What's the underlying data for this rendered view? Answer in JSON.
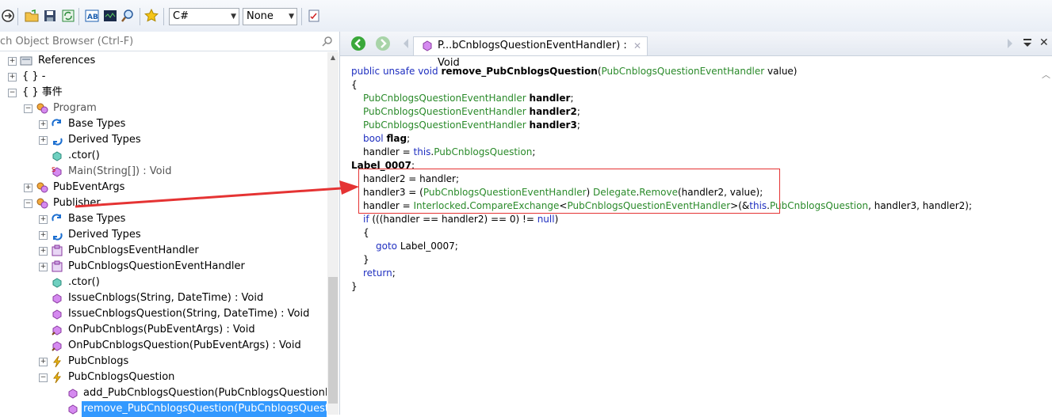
{
  "toolbar": {
    "language": "C#",
    "optimization": "None",
    "colors": {
      "back_icon": "#2c2c2c"
    }
  },
  "browser": {
    "search_placeholder": "ch Object Browser (Ctrl-F)",
    "tree": [
      {
        "label": "References"
      },
      {
        "label": "{ } -"
      },
      {
        "label": "{ } 事件"
      },
      {
        "label": "Program"
      },
      {
        "label": "Base Types"
      },
      {
        "label": "Derived Types"
      },
      {
        "label": ".ctor()"
      },
      {
        "label": "Main(String[]) : Void"
      },
      {
        "label": "PubEventArgs"
      },
      {
        "label": "Publisher"
      },
      {
        "label": "Base Types"
      },
      {
        "label": "Derived Types"
      },
      {
        "label": "PubCnblogsEventHandler"
      },
      {
        "label": "PubCnblogsQuestionEventHandler"
      },
      {
        "label": ".ctor()"
      },
      {
        "label": "IssueCnblogs(String, DateTime) : Void"
      },
      {
        "label": "IssueCnblogsQuestion(String, DateTime) : Void"
      },
      {
        "label": "OnPubCnblogs(PubEventArgs) : Void"
      },
      {
        "label": "OnPubCnblogsQuestion(PubEventArgs) : Void"
      },
      {
        "label": "PubCnblogs"
      },
      {
        "label": "PubCnblogsQuestion"
      },
      {
        "label": "add_PubCnblogsQuestion(PubCnblogsQuestionEvent"
      },
      {
        "label": "remove_PubCnblogsQuestion(PubCnblogsQuestionEv"
      }
    ]
  },
  "editor": {
    "tab_title": "P...bCnblogsQuestionEventHandler) : Void",
    "code": {
      "l1_public": "public",
      "l1_unsafe": "unsafe",
      "l1_void": "void",
      "l1_name": "remove_PubCnblogsQuestion",
      "l1_paren_open": "(",
      "l1_ptype": "PubCnblogsQuestionEventHandler",
      "l1_pname": " value)",
      "l2": "{",
      "l3_type": "PubCnblogsQuestionEventHandler",
      "l3_var": "handler",
      "l4_type": "PubCnblogsQuestionEventHandler",
      "l4_var": "handler2",
      "l5_type": "PubCnblogsQuestionEventHandler",
      "l5_var": "handler3",
      "l6_type": "bool",
      "l6_var": "flag",
      "semi": ";",
      "l7_a": "handler = ",
      "l7_this": "this",
      "l7_b": ".",
      "l7_c": "PubCnblogsQuestion",
      "l8": "Label_0007",
      "l8_colon": ":",
      "l9": "handler2 = handler;",
      "l10_a": "handler3 = (",
      "l10_type": "PubCnblogsQuestionEventHandler",
      "l10_b": ") ",
      "l10_delegate": "Delegate",
      "l10_c": ".",
      "l10_remove": "Remove",
      "l10_d": "(handler2, value);",
      "l11_a": "handler = ",
      "l11_inter": "Interlocked",
      "l11_b": ".",
      "l11_ce": "CompareExchange",
      "l11_lt": "<",
      "l11_type": "PubCnblogsQuestionEventHandler",
      "l11_gt": ">",
      "l11_c": "(&",
      "l11_this": "this",
      "l11_d": ".",
      "l11_e": "PubCnblogsQuestion",
      "l11_f": ", handler3, handler2);",
      "l12_if": "if",
      "l12_a": " (((handler == handler2) == 0) != ",
      "l12_null": "null",
      "l12_b": ")",
      "l13": "{",
      "l14_goto": "goto",
      "l14_a": " Label_0007;",
      "l15": "}",
      "l16_ret": "return",
      "l16_a": ";",
      "l17": "}"
    }
  }
}
